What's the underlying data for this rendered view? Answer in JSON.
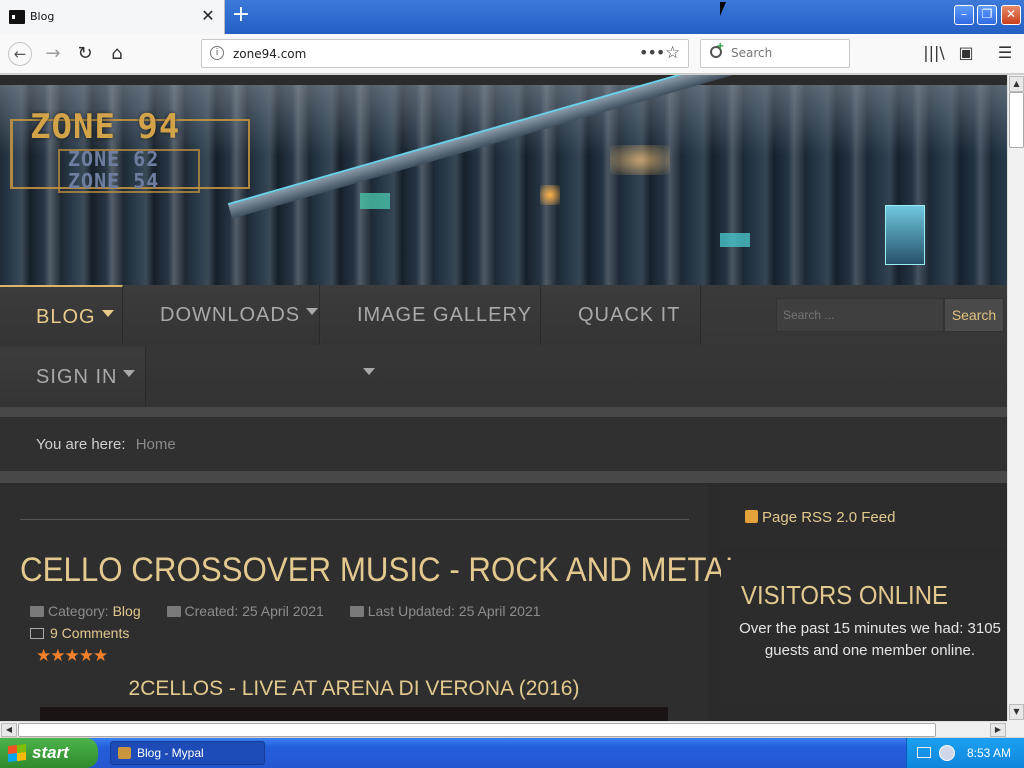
{
  "browser": {
    "tab_title": "Blog",
    "tab_close": "✕",
    "new_tab": "+",
    "url": "zone94.com",
    "search_placeholder": "Search",
    "window_buttons": {
      "minimize": "–",
      "maximize": "❐",
      "close": "✕"
    }
  },
  "banner": {
    "logo_main": "ZONE 94",
    "logo_sub1": "ZONE 62",
    "logo_sub2": "ZONE 54"
  },
  "menu": {
    "items": [
      {
        "label": "BLOG",
        "active": true,
        "dropdown": true
      },
      {
        "label": "DOWNLOADS",
        "active": false,
        "dropdown": true
      },
      {
        "label": "IMAGE GALLERY",
        "active": false,
        "dropdown": true
      },
      {
        "label": "QUACK IT",
        "active": false,
        "dropdown": false
      },
      {
        "label": "SIGN IN",
        "active": false,
        "dropdown": true
      }
    ],
    "search_placeholder": "Search ...",
    "search_button": "Search"
  },
  "breadcrumb": {
    "prefix": "You are here:",
    "home": "Home"
  },
  "article": {
    "title": "CELLO CROSSOVER MUSIC - ROCK AND METAL",
    "category_label": "Category:",
    "category": "Blog",
    "created": "Created: 25 April 2021",
    "updated": "Last Updated: 25 April 2021",
    "comments": "9 Comments",
    "rating_stars": 5,
    "stars_text": "★★★★★",
    "video_title": "2CELLOS - LIVE AT ARENA DI VERONA (2016)"
  },
  "sidebar": {
    "rss": "Page RSS 2.0 Feed",
    "visitors_title": "VISITORS ONLINE",
    "visitors_text": "Over the past 15 minutes we had: 3105 guests and one member online."
  },
  "taskbar": {
    "start": "start",
    "task_label": "Blog - Mypal",
    "clock": "8:53 AM"
  },
  "colors": {
    "accent_gold": "#e3c98e",
    "page_bg": "#2b2b2b",
    "star_orange": "#f3812c",
    "xp_blue": "#245edb"
  }
}
